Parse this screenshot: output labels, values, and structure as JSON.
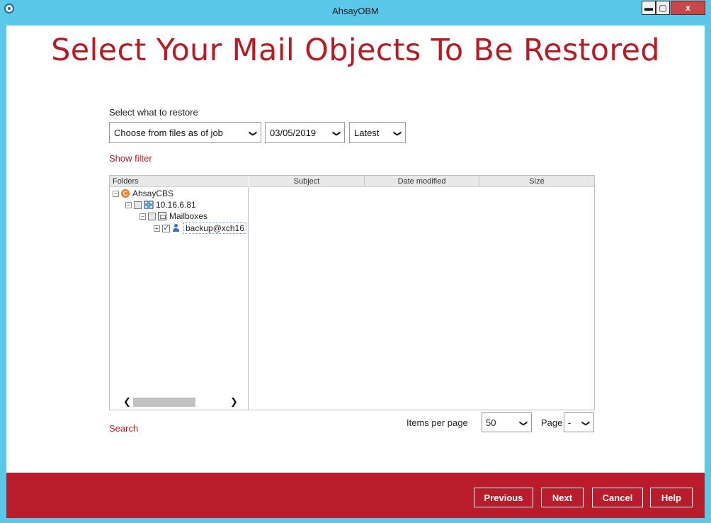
{
  "window": {
    "title": "AhsayOBM",
    "controls": {
      "minimize": "▬",
      "maximize": "▢",
      "close": "x"
    }
  },
  "heading": "Select Your Mail Objects To Be Restored",
  "restore": {
    "label": "Select what to restore",
    "job_option": "Choose from files as of job",
    "date": "03/05/2019",
    "version": "Latest"
  },
  "show_filter": "Show filter",
  "table": {
    "columns": [
      "Folders",
      "Subject",
      "Date modified",
      "Size"
    ],
    "tree": [
      {
        "label": "AhsayCBS",
        "icon": "ahsaycbs-icon",
        "expanded": true,
        "checked": false
      },
      {
        "label": "10.16.6.81",
        "icon": "exchange-server-icon",
        "expanded": true,
        "checked": false
      },
      {
        "label": "Mailboxes",
        "icon": "mailbox-folder-icon",
        "expanded": true,
        "checked": false
      },
      {
        "label": "backup@xch16",
        "icon": "user-icon",
        "expanded": false,
        "checked": true
      }
    ]
  },
  "search": "Search",
  "pager": {
    "items_per_page_label": "Items per page",
    "items_per_page": "50",
    "page_label": "Page",
    "page": "-"
  },
  "footer": {
    "previous": "Previous",
    "next": "Next",
    "cancel": "Cancel",
    "help": "Help"
  },
  "colors": {
    "accent": "#b71c24",
    "titlebar": "#5bc8ea",
    "footer": "#b91c2a"
  }
}
